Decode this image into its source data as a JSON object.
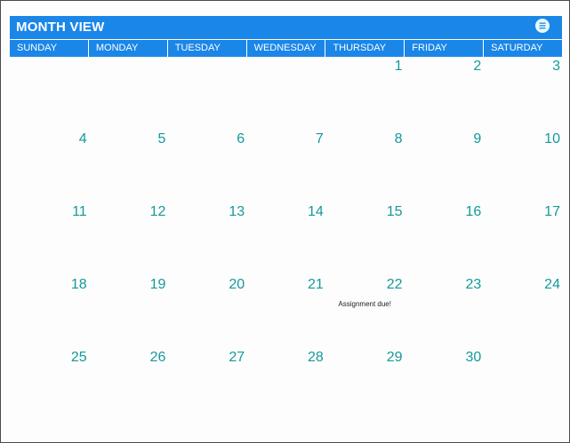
{
  "header": {
    "title": "MONTH VIEW",
    "menu_icon": "list-icon"
  },
  "days": [
    "SUNDAY",
    "MONDAY",
    "TUESDAY",
    "WEDNESDAY",
    "THURSDAY",
    "FRIDAY",
    "SATURDAY"
  ],
  "weeks": [
    [
      {
        "day": "",
        "note": ""
      },
      {
        "day": "",
        "note": ""
      },
      {
        "day": "",
        "note": ""
      },
      {
        "day": "",
        "note": ""
      },
      {
        "day": "1",
        "note": ""
      },
      {
        "day": "2",
        "note": ""
      },
      {
        "day": "3",
        "note": ""
      }
    ],
    [
      {
        "day": "4",
        "note": ""
      },
      {
        "day": "5",
        "note": ""
      },
      {
        "day": "6",
        "note": ""
      },
      {
        "day": "7",
        "note": ""
      },
      {
        "day": "8",
        "note": ""
      },
      {
        "day": "9",
        "note": ""
      },
      {
        "day": "10",
        "note": ""
      }
    ],
    [
      {
        "day": "11",
        "note": ""
      },
      {
        "day": "12",
        "note": ""
      },
      {
        "day": "13",
        "note": ""
      },
      {
        "day": "14",
        "note": ""
      },
      {
        "day": "15",
        "note": ""
      },
      {
        "day": "16",
        "note": ""
      },
      {
        "day": "17",
        "note": ""
      }
    ],
    [
      {
        "day": "18",
        "note": ""
      },
      {
        "day": "19",
        "note": ""
      },
      {
        "day": "20",
        "note": ""
      },
      {
        "day": "21",
        "note": ""
      },
      {
        "day": "22",
        "note": "Assignment due!"
      },
      {
        "day": "23",
        "note": ""
      },
      {
        "day": "24",
        "note": ""
      }
    ],
    [
      {
        "day": "25",
        "note": ""
      },
      {
        "day": "26",
        "note": ""
      },
      {
        "day": "27",
        "note": ""
      },
      {
        "day": "28",
        "note": ""
      },
      {
        "day": "29",
        "note": ""
      },
      {
        "day": "30",
        "note": ""
      },
      {
        "day": "",
        "note": ""
      }
    ]
  ],
  "colors": {
    "header_bg": "#1a86e8",
    "day_number": "#149a9a",
    "menu_button": "#e8fbfa"
  }
}
